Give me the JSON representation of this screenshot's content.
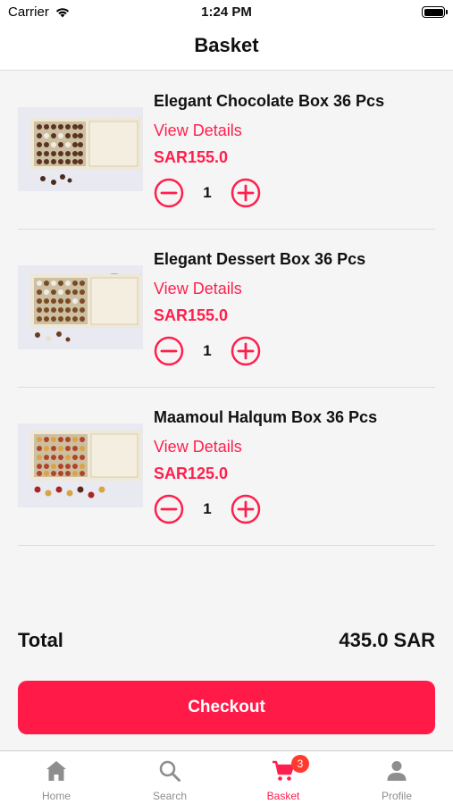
{
  "status_bar": {
    "carrier": "Carrier",
    "time": "1:24 PM"
  },
  "header": {
    "title": "Basket"
  },
  "items": [
    {
      "name": "Elegant Chocolate Box 36 Pcs",
      "details_label": "View Details",
      "price": "SAR155.0",
      "quantity": "1"
    },
    {
      "name": "Elegant Dessert Box 36 Pcs",
      "details_label": "View Details",
      "price": "SAR155.0",
      "quantity": "1"
    },
    {
      "name": "Maamoul Halqum Box 36 Pcs",
      "details_label": "View Details",
      "price": "SAR125.0",
      "quantity": "1"
    }
  ],
  "summary": {
    "total_label": "Total",
    "total_value": "435.0 SAR"
  },
  "checkout": {
    "label": "Checkout"
  },
  "tabs": [
    {
      "label": "Home",
      "icon": "home-icon"
    },
    {
      "label": "Search",
      "icon": "search-icon"
    },
    {
      "label": "Basket",
      "icon": "cart-icon",
      "badge": "3"
    },
    {
      "label": "Profile",
      "icon": "person-icon"
    }
  ],
  "colors": {
    "accent": "#ff1f4d",
    "inactive": "#8e8e8e",
    "badge": "#ff3b30"
  }
}
